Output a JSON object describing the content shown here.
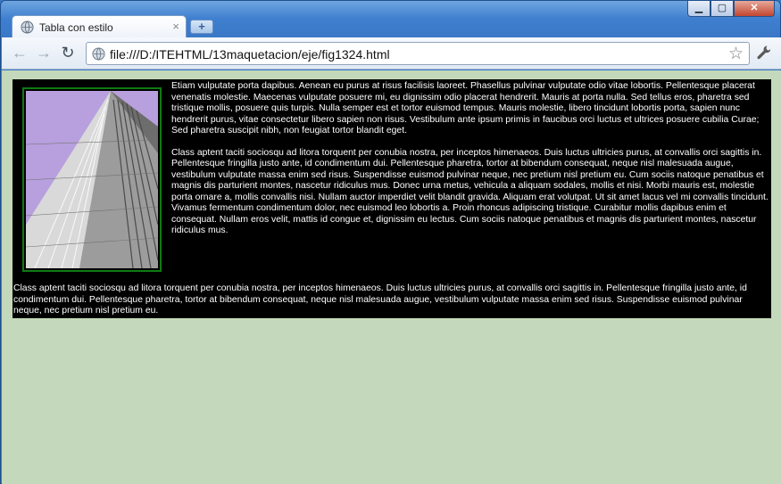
{
  "browser": {
    "tab_title": "Tabla con estilo",
    "tab_close_glyph": "×",
    "new_tab_glyph": "+",
    "window_buttons": {
      "minimize": "▁",
      "maximize": "▢",
      "close": "✕"
    },
    "nav": {
      "back": "←",
      "forward": "→",
      "reload": "↻"
    },
    "address_url": "file:///D:/ITEHTML/13maquetacion/eje/fig1324.html",
    "bookmark_star": "☆",
    "menu_wrench": "🔧",
    "icons": [
      "globe-icon",
      "back-arrow-icon",
      "forward-arrow-icon",
      "reload-icon",
      "star-icon",
      "wrench-icon",
      "close-icon",
      "plus-icon"
    ]
  },
  "page": {
    "background_color": "#c4d9bb",
    "table_background": "#000000",
    "text_color": "#ffffff",
    "image_border_color": "#0f7a14",
    "paragraph_1": "Etiam vulputate porta dapibus. Aenean eu purus at risus facilisis laoreet. Phasellus pulvinar vulputate odio vitae lobortis. Pellentesque placerat venenatis molestie. Maecenas vulputate posuere mi, eu dignissim odio placerat hendrerit. Mauris at porta nulla. Sed tellus eros, pharetra sed tristique mollis, posuere quis turpis. Nulla semper est et tortor euismod tempus. Mauris molestie, libero tincidunt lobortis porta, sapien nunc hendrerit purus, vitae consectetur libero sapien non risus. Vestibulum ante ipsum primis in faucibus orci luctus et ultrices posuere cubilia Curae; Sed pharetra suscipit nibh, non feugiat tortor blandit eget.",
    "paragraph_2": "Class aptent taciti sociosqu ad litora torquent per conubia nostra, per inceptos himenaeos. Duis luctus ultricies purus, at convallis orci sagittis in. Pellentesque fringilla justo ante, id condimentum dui. Pellentesque pharetra, tortor at bibendum consequat, neque nisl malesuada augue, vestibulum vulputate massa enim sed risus. Suspendisse euismod pulvinar neque, nec pretium nisl pretium eu. Cum sociis natoque penatibus et magnis dis parturient montes, nascetur ridiculus mus. Donec urna metus, vehicula a aliquam sodales, mollis et nisi. Morbi mauris est, molestie porta ornare a, mollis convallis nisi. Nullam auctor imperdiet velit blandit gravida. Aliquam erat volutpat. Ut sit amet lacus vel mi convallis tincidunt. Vivamus fermentum condimentum dolor, nec euismod leo lobortis a. Proin rhoncus adipiscing tristique. Curabitur mollis dapibus enim et consequat. Nullam eros velit, mattis id congue et, dignissim eu lectus. Cum sociis natoque penatibus et magnis dis parturient montes, nascetur ridiculus mus.",
    "footer_text": "Class aptent taciti sociosqu ad litora torquent per conubia nostra, per inceptos himenaeos. Duis luctus ultricies purus, at convallis orci sagittis in. Pellentesque fringilla justo ante, id condimentum dui. Pellentesque pharetra, tortor at bibendum consequat, neque nisl malesuada augue, vestibulum vulputate massa enim sed risus. Suspendisse euismod pulvinar neque, nec pretium nisl pretium eu."
  }
}
